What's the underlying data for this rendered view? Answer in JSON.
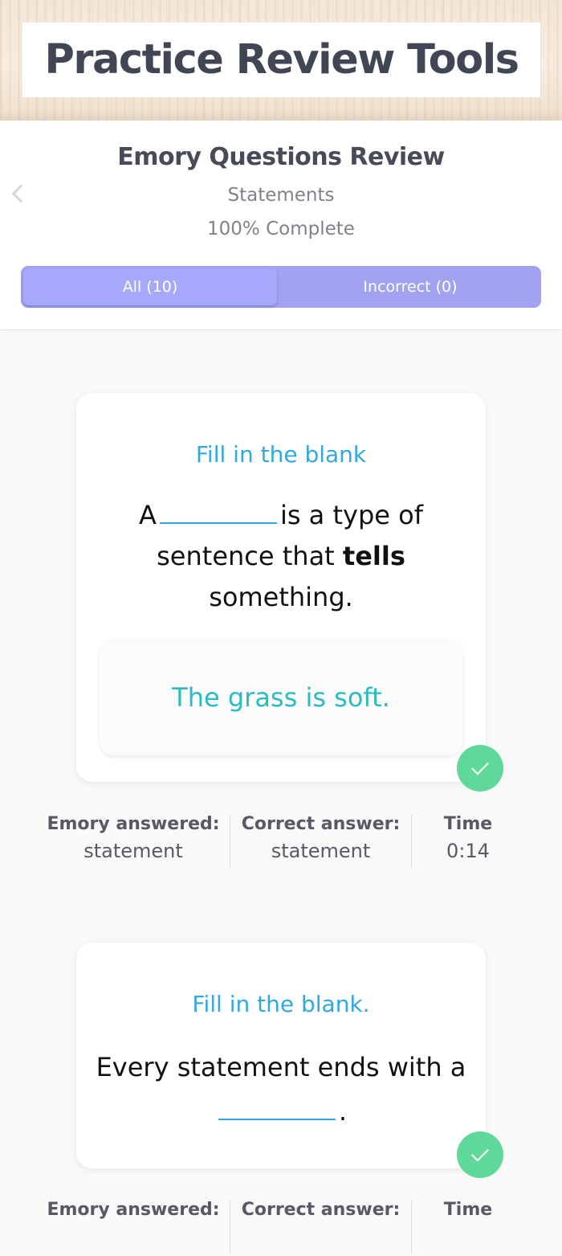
{
  "banner": {
    "title": "Practice Review Tools"
  },
  "header": {
    "title": "Emory Questions Review",
    "subtitle": "Statements",
    "progress": "100% Complete",
    "progress_percent": 100,
    "back_icon": "chevron-left-icon"
  },
  "filter": {
    "all_label": "All (10)",
    "incorrect_label": "Incorrect (0)",
    "selected": "All (10)"
  },
  "colors": {
    "accent": "#a6a8fb",
    "prompt": "#32a8e0",
    "example": "#2bbbc2",
    "correct": "#5fd99a"
  },
  "questions": [
    {
      "prompt": "Fill in the blank",
      "text_before": "A",
      "text_after": "is a type of sentence that",
      "text_bold": "tells",
      "text_end": "something.",
      "example": "The grass is soft.",
      "status_icon": "check-icon",
      "stats": {
        "answered_label": "Emory answered:",
        "answered_value": "statement",
        "correct_label": "Correct answer:",
        "correct_value": "statement",
        "time_label": "Time",
        "time_value": "0:14"
      }
    },
    {
      "prompt": "Fill in the blank.",
      "text_before": "Every statement ends with a",
      "text_end": ".",
      "status_icon": "check-icon",
      "stats": {
        "answered_label": "Emory answered:",
        "correct_label": "Correct answer:",
        "time_label": "Time"
      }
    }
  ]
}
